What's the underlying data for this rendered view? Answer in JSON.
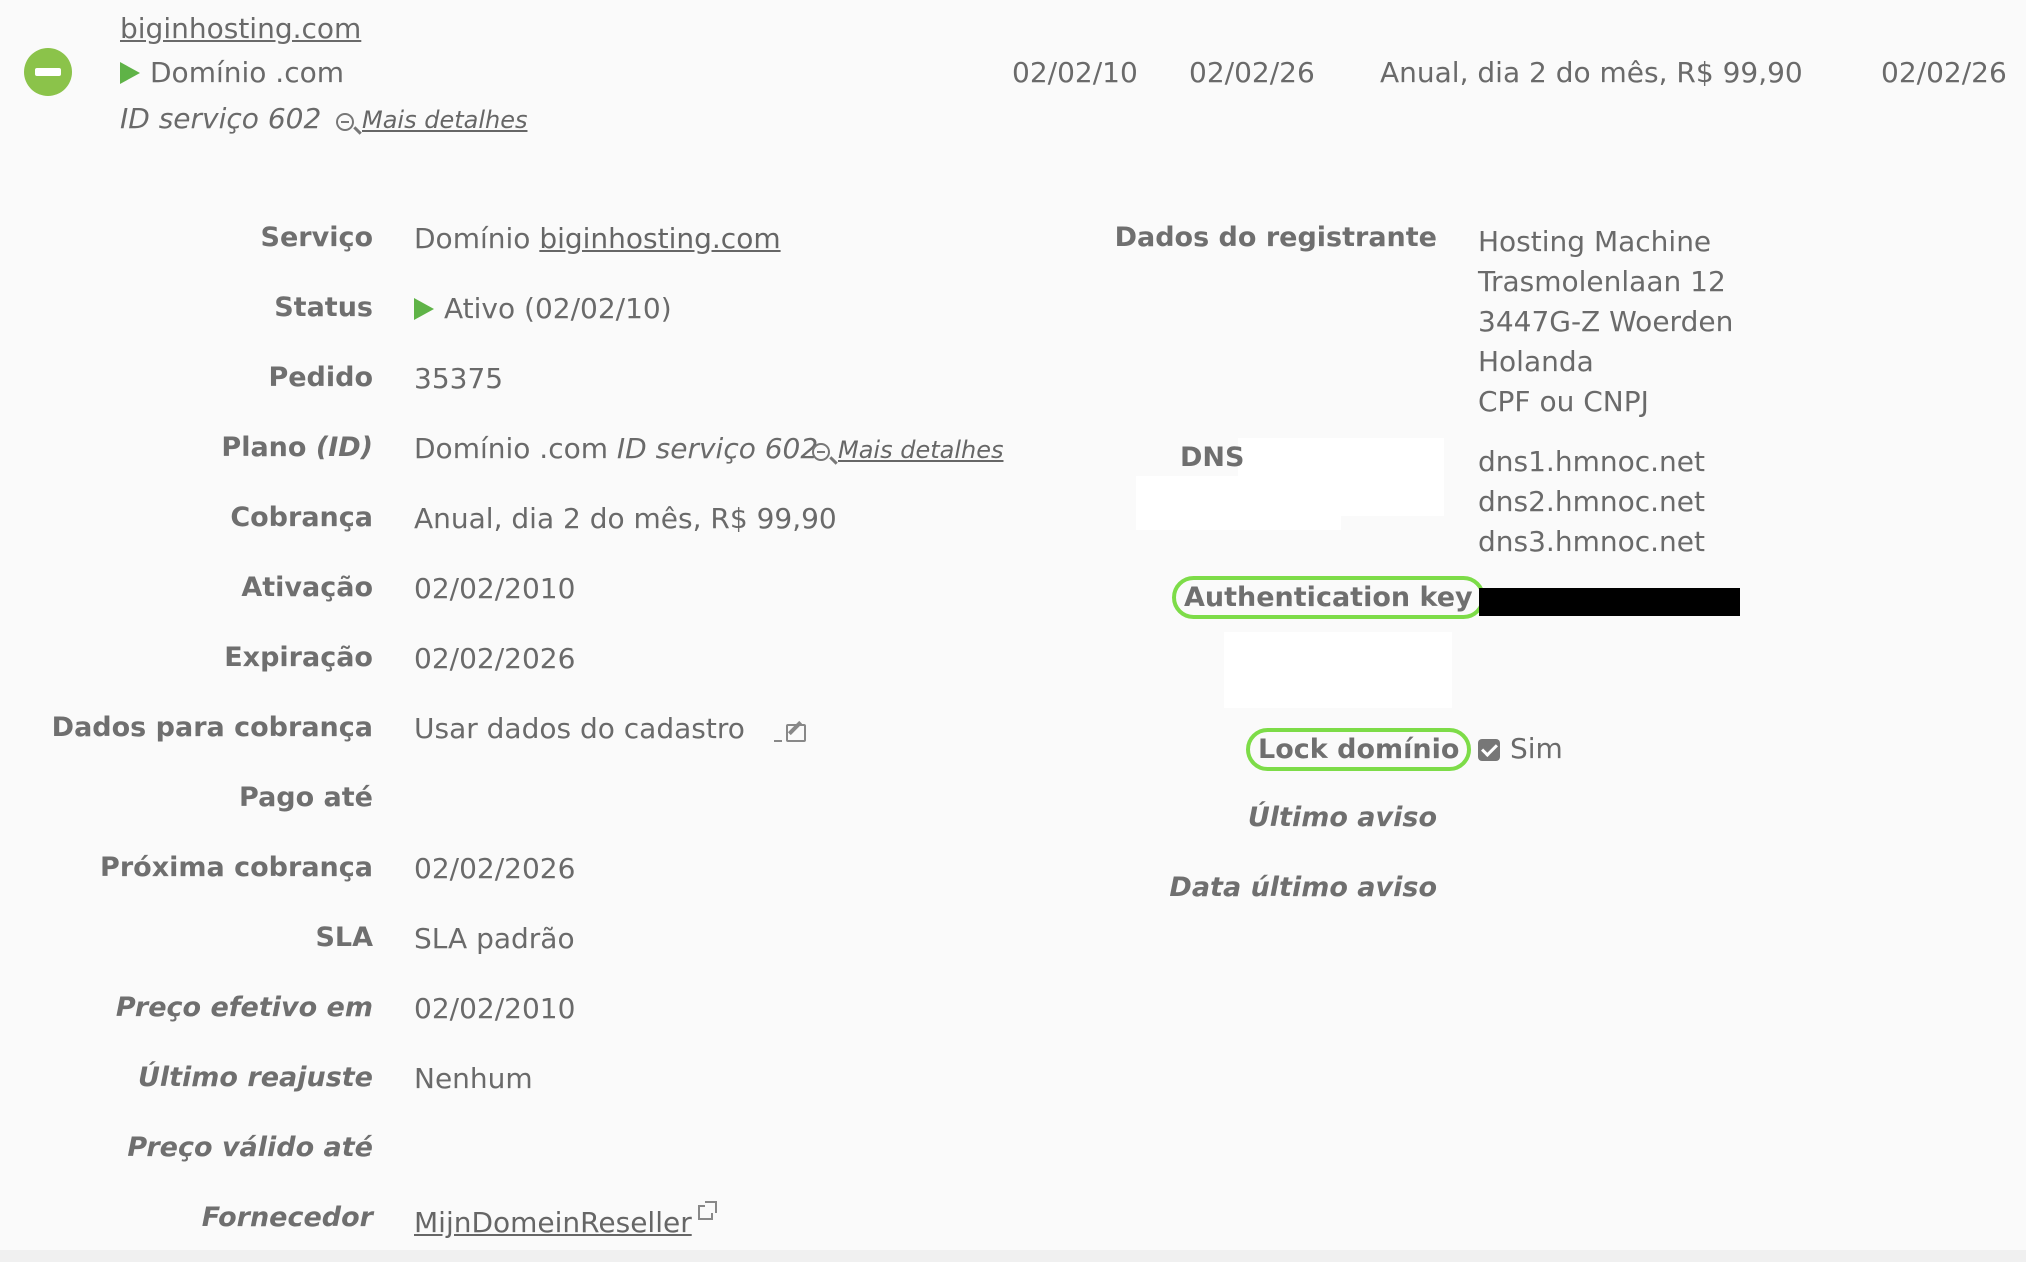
{
  "header": {
    "domain_link": "biginhosting.com",
    "product": "Domínio .com",
    "service_id": "ID serviço 602",
    "more_details": "Mais detalhes",
    "date_start": "02/02/10",
    "date_end": "02/02/26",
    "billing": "Anual, dia 2 do mês, R$ 99,90",
    "next_date": "02/02/26"
  },
  "left": {
    "servico": {
      "label": "Serviço",
      "prefix": "Domínio",
      "link": "biginhosting.com"
    },
    "status": {
      "label": "Status",
      "value": "Ativo (02/02/10)"
    },
    "pedido": {
      "label": "Pedido",
      "value": "35375"
    },
    "plano": {
      "label_main": "Plano",
      "label_id": "(ID)",
      "value": "Domínio .com",
      "service_id": "ID serviço 602",
      "more_details": "Mais detalhes"
    },
    "cobranca": {
      "label": "Cobrança",
      "value": "Anual, dia 2 do mês, R$ 99,90"
    },
    "ativacao": {
      "label": "Ativação",
      "value": "02/02/2010"
    },
    "expiracao": {
      "label": "Expiração",
      "value": "02/02/2026"
    },
    "dados_cobranca": {
      "label": "Dados para cobrança",
      "value": "Usar dados do cadastro"
    },
    "pago_ate": {
      "label": "Pago até",
      "value": ""
    },
    "proxima_cobranca": {
      "label": "Próxima cobrança",
      "value": "02/02/2026"
    },
    "sla": {
      "label": "SLA",
      "value": "SLA padrão"
    },
    "preco_efetivo": {
      "label": "Preço efetivo em",
      "value": "02/02/2010"
    },
    "ultimo_reajuste": {
      "label": "Último reajuste",
      "value": "Nenhum"
    },
    "preco_valido": {
      "label": "Preço válido até",
      "value": ""
    },
    "fornecedor": {
      "label": "Fornecedor",
      "value": "MijnDomeinReseller"
    }
  },
  "right": {
    "registrante": {
      "label": "Dados do registrante",
      "lines": [
        "Hosting Machine",
        "Trasmolenlaan 12",
        "3447G-Z Woerden",
        "Holanda",
        "CPF ou CNPJ"
      ]
    },
    "dns": {
      "label": "DNS",
      "servers": [
        "dns1.hmnoc.net",
        "dns2.hmnoc.net",
        "dns3.hmnoc.net"
      ]
    },
    "auth_key": {
      "label": "Authentication key"
    },
    "lock": {
      "label": "Lock domínio",
      "value": "Sim"
    },
    "ultimo_aviso": {
      "label": "Último aviso"
    },
    "data_ultimo_aviso": {
      "label": "Data último aviso"
    }
  },
  "colors": {
    "accent_green": "#8bc34a",
    "status_green": "#5fb347",
    "highlight": "#7ddc48"
  }
}
